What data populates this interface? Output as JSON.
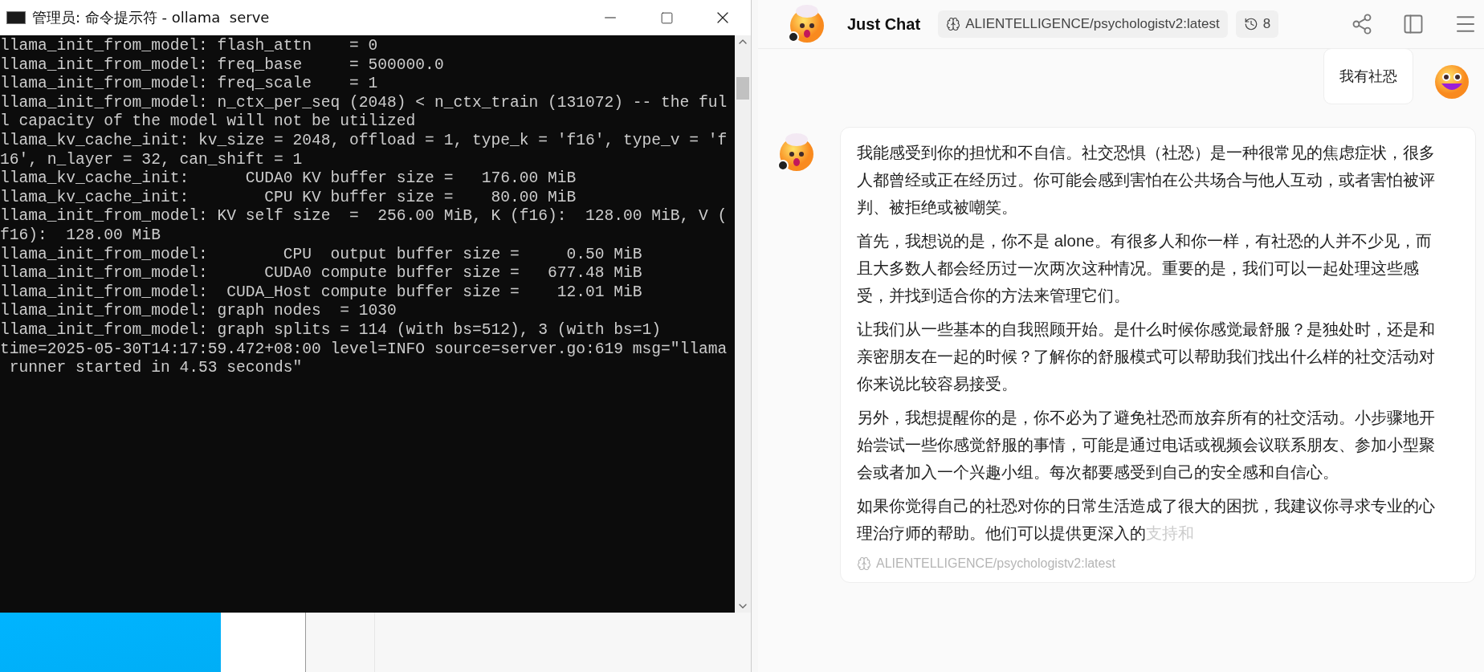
{
  "terminal": {
    "title": "管理员: 命令提示符 - ollama  serve",
    "lines": [
      "llama_init_from_model: flash_attn    = 0",
      "llama_init_from_model: freq_base     = 500000.0",
      "llama_init_from_model: freq_scale    = 1",
      "llama_init_from_model: n_ctx_per_seq (2048) < n_ctx_train (131072) -- the ful",
      "l capacity of the model will not be utilized",
      "llama_kv_cache_init: kv_size = 2048, offload = 1, type_k = 'f16', type_v = 'f",
      "16', n_layer = 32, can_shift = 1",
      "llama_kv_cache_init:      CUDA0 KV buffer size =   176.00 MiB",
      "llama_kv_cache_init:        CPU KV buffer size =    80.00 MiB",
      "llama_init_from_model: KV self size  =  256.00 MiB, K (f16):  128.00 MiB, V (",
      "f16):  128.00 MiB",
      "llama_init_from_model:        CPU  output buffer size =     0.50 MiB",
      "llama_init_from_model:      CUDA0 compute buffer size =   677.48 MiB",
      "llama_init_from_model:  CUDA_Host compute buffer size =    12.01 MiB",
      "llama_init_from_model: graph nodes  = 1030",
      "llama_init_from_model: graph splits = 114 (with bs=512), 3 (with bs=1)",
      "time=2025-05-30T14:17:59.472+08:00 level=INFO source=server.go:619 msg=\"llama",
      " runner started in 4.53 seconds\""
    ]
  },
  "chat": {
    "title": "Just Chat",
    "model": "ALIENTELLIGENCE/psychologistv2:latest",
    "history_count": "8",
    "messages": [
      {
        "kind": "user",
        "paragraphs": [
          {
            "text": "我有社恐"
          }
        ]
      },
      {
        "kind": "assistant",
        "footer": "ALIENTELLIGENCE/psychologistv2:latest",
        "paragraphs": [
          {
            "text": "我能感受到你的担忧和不自信。社交恐惧（社恐）是一种很常见的焦虑症状，很多人都曾经或正在经历过。你可能会感到害怕在公共场合与他人互动，或者害怕被评判、被拒绝或被嘲笑。"
          },
          {
            "text": "首先，我想说的是，你不是 alone。有很多人和你一样，有社恐的人并不少见，而且大多数人都会经历过一次两次这种情况。重要的是，我们可以一起处理这些感受，并找到适合你的方法来管理它们。"
          },
          {
            "text": "让我们从一些基本的自我照顾开始。是什么时候你感觉最舒服？是独处时，还是和亲密朋友在一起的时候？了解你的舒服模式可以帮助我们找出什么样的社交活动对你来说比较容易接受。"
          },
          {
            "text": "另外，我想提醒你的是，你不必为了避免社恐而放弃所有的社交活动。小步骤地开始尝试一些你感觉舒服的事情，可能是通过电话或视频会议联系朋友、参加小型聚会或者加入一个兴趣小组。每次都要感受到自己的安全感和自信心。"
          },
          {
            "text": "如果你觉得自己的社恐对你的日常生活造成了很大的困扰，我建议你寻求专业的心理治疗师的帮助。他们可以提供更深入的",
            "fading_tail": "支持和"
          }
        ]
      }
    ]
  }
}
